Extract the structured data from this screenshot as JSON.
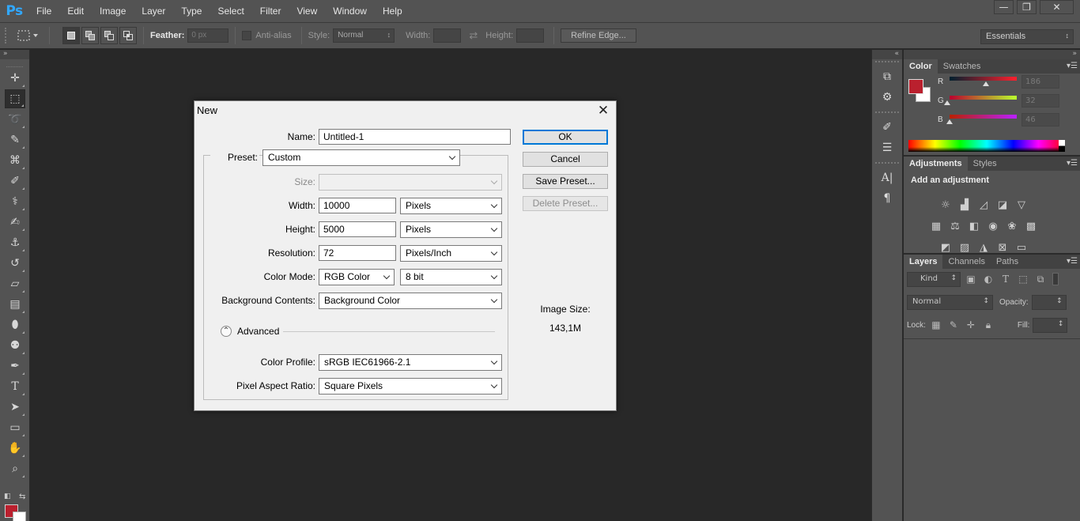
{
  "app": {
    "logo": "Ps"
  },
  "menu": [
    "File",
    "Edit",
    "Image",
    "Layer",
    "Type",
    "Select",
    "Filter",
    "View",
    "Window",
    "Help"
  ],
  "window_controls": {
    "minimize": "—",
    "restore": "❐",
    "close": "✕"
  },
  "options_bar": {
    "feather_label": "Feather:",
    "feather_placeholder": "0 px",
    "antialias_label": "Anti-alias",
    "style_label": "Style:",
    "style_value": "Normal",
    "width_label": "Width:",
    "height_label": "Height:",
    "refine_edge": "Refine Edge...",
    "workspace": "Essentials"
  },
  "tools": [
    {
      "name": "move-tool",
      "glyph": "✛"
    },
    {
      "name": "rectangular-marquee-tool",
      "glyph": "⬚"
    },
    {
      "name": "lasso-tool",
      "glyph": "➰"
    },
    {
      "name": "quick-selection-tool",
      "glyph": "✎"
    },
    {
      "name": "crop-tool",
      "glyph": "⌘"
    },
    {
      "name": "eyedropper-tool",
      "glyph": "✐"
    },
    {
      "name": "healing-brush-tool",
      "glyph": "⚕"
    },
    {
      "name": "brush-tool",
      "glyph": "✍"
    },
    {
      "name": "clone-stamp-tool",
      "glyph": "⚓"
    },
    {
      "name": "history-brush-tool",
      "glyph": "↺"
    },
    {
      "name": "eraser-tool",
      "glyph": "▱"
    },
    {
      "name": "gradient-tool",
      "glyph": "▤"
    },
    {
      "name": "blur-tool",
      "glyph": "⬮"
    },
    {
      "name": "dodge-tool",
      "glyph": "⚉"
    },
    {
      "name": "pen-tool",
      "glyph": "✒"
    },
    {
      "name": "type-tool",
      "glyph": "T"
    },
    {
      "name": "path-selection-tool",
      "glyph": "➤"
    },
    {
      "name": "rectangle-tool",
      "glyph": "▭"
    },
    {
      "name": "hand-tool",
      "glyph": "✋"
    },
    {
      "name": "zoom-tool",
      "glyph": "⌕"
    }
  ],
  "panels": {
    "color": {
      "tabs": [
        "Color",
        "Swatches"
      ],
      "r_label": "R",
      "g_label": "G",
      "b_label": "B",
      "r": "186",
      "g": "32",
      "b": "46",
      "foreground": "#ba202e",
      "background": "#ffffff"
    },
    "adjustments": {
      "tabs": [
        "Adjustments",
        "Styles"
      ],
      "title": "Add an adjustment"
    },
    "layers": {
      "tabs": [
        "Layers",
        "Channels",
        "Paths"
      ],
      "filter_kind": "Kind",
      "blend_mode": "Normal",
      "opacity_label": "Opacity:",
      "lock_label": "Lock:",
      "fill_label": "Fill:"
    }
  },
  "dialog": {
    "title": "New",
    "name_label": "Name:",
    "name_value": "Untitled-1",
    "preset_label": "Preset:",
    "preset_value": "Custom",
    "size_label": "Size:",
    "width_label": "Width:",
    "width_value": "10000",
    "width_unit": "Pixels",
    "height_label": "Height:",
    "height_value": "5000",
    "height_unit": "Pixels",
    "resolution_label": "Resolution:",
    "resolution_value": "72",
    "resolution_unit": "Pixels/Inch",
    "color_mode_label": "Color Mode:",
    "color_mode_value": "RGB Color",
    "bit_depth_value": "8 bit",
    "bg_contents_label": "Background Contents:",
    "bg_contents_value": "Background Color",
    "advanced_label": "Advanced",
    "color_profile_label": "Color Profile:",
    "color_profile_value": "sRGB IEC61966-2.1",
    "pixel_aspect_label": "Pixel Aspect Ratio:",
    "pixel_aspect_value": "Square Pixels",
    "ok": "OK",
    "cancel": "Cancel",
    "save_preset": "Save Preset...",
    "delete_preset": "Delete Preset...",
    "image_size_label": "Image Size:",
    "image_size_value": "143,1M"
  }
}
